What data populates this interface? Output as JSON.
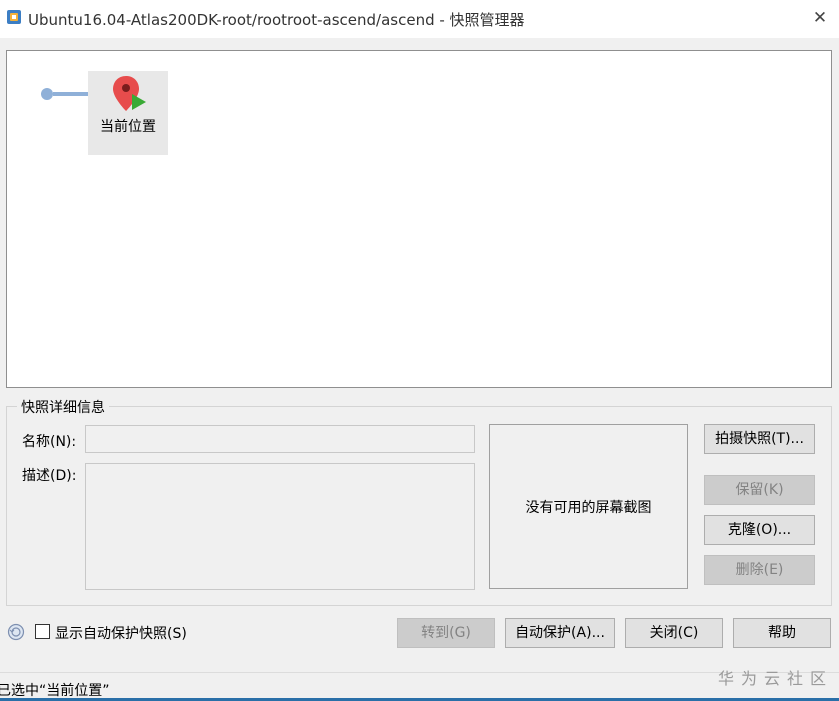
{
  "window": {
    "title": "Ubuntu16.04-Atlas200DK-root/rootroot-ascend/ascend - 快照管理器",
    "close_glyph": "✕"
  },
  "tree": {
    "current_node_label": "当前位置"
  },
  "details": {
    "legend": "快照详细信息",
    "name_label": "名称(N):",
    "name_value": "",
    "desc_label": "描述(D):",
    "desc_value": "",
    "screenshot_placeholder": "没有可用的屏幕截图"
  },
  "side_buttons": {
    "take_snapshot": "拍摄快照(T)...",
    "keep": "保留(K)",
    "clone": "克隆(O)...",
    "delete": "删除(E)"
  },
  "bottom": {
    "show_autoprotect_label": "显示自动保护快照(S)",
    "show_autoprotect_checked": false,
    "goto": "转到(G)",
    "autoprotect": "自动保护(A)...",
    "close": "关闭(C)",
    "help": "帮助"
  },
  "status": {
    "text": "已选中“当前位置”"
  },
  "watermark": "华为云社区",
  "colors": {
    "pin_red": "#e74c4c",
    "play_green": "#3aaa35",
    "connector_blue": "#8fb0d8",
    "status_line": "#2a6fa8"
  },
  "icons": {
    "app": "vmware-workstation-icon",
    "current_position": "map-pin-play-icon",
    "history": "snapshot-history-icon"
  }
}
